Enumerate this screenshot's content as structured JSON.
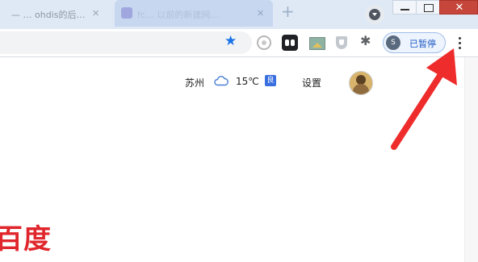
{
  "window": {
    "close_glyph": "✕"
  },
  "tabs": [
    {
      "title": "—  …  ohdis的后…",
      "close": "✕",
      "active": false
    },
    {
      "title": "fc… 以前的新建网…",
      "close": "✕",
      "active": true
    }
  ],
  "toolbar": {
    "bookmark_icon": "★",
    "extensions_icon": "✱",
    "profile_button": {
      "avatar_letter": "S",
      "label": "已暂停"
    }
  },
  "header_bar": {
    "city": "苏州",
    "temperature": "15℃",
    "air_quality": "良",
    "settings_link": "设置"
  },
  "logo": {
    "text": "百度"
  },
  "colors": {
    "tabstrip_bg": "#dfe9f6",
    "accent_blue": "#1a73e8",
    "baidu_red": "#e0262c",
    "arrow_red": "#ee2c2c"
  }
}
